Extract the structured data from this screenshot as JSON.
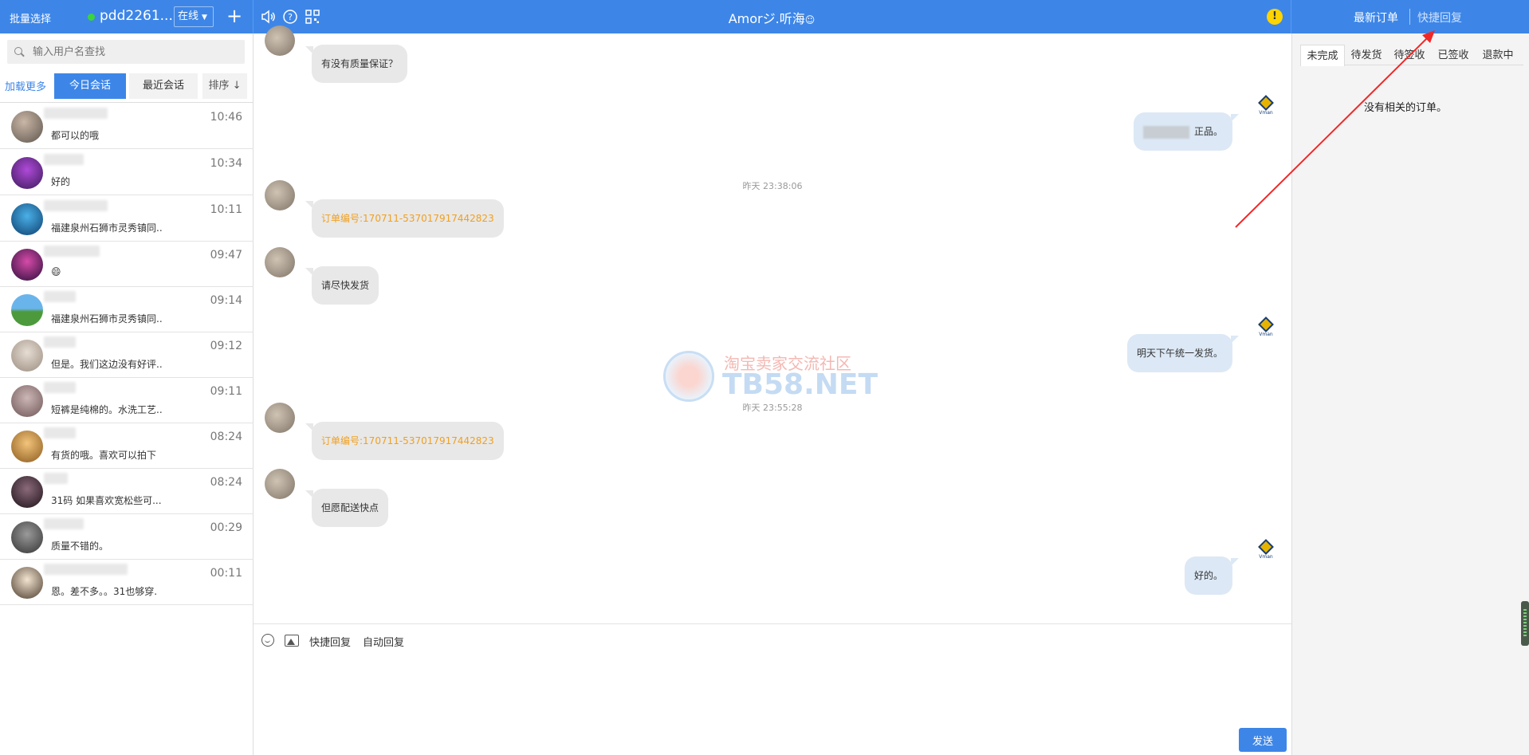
{
  "topbar": {
    "batch_select": "批量选择",
    "shop_name": "pdd2261...",
    "status": "在线",
    "add": "+",
    "chat_title": "Amorジ.听海",
    "alert": "!",
    "latest_orders": "最新订单",
    "quick_reply": "快捷回复",
    "icons": [
      "speaker-icon",
      "help-icon",
      "qrcode-icon"
    ],
    "accent_color": "#3d86e8"
  },
  "sidebar": {
    "search_placeholder": "输入用户名查找",
    "load_more": "加载更多",
    "tabs": [
      "今日会话",
      "最近会话",
      "排序 ↓"
    ],
    "conversations": [
      {
        "time": "10:46",
        "msg": "都可以的哦"
      },
      {
        "time": "10:34",
        "msg": "好的"
      },
      {
        "time": "10:11",
        "msg": "福建泉州石狮市灵秀镇同.."
      },
      {
        "time": "09:47",
        "msg": "😄"
      },
      {
        "time": "09:14",
        "msg": "福建泉州石狮市灵秀镇同.."
      },
      {
        "time": "09:12",
        "msg": "但是。我们这边没有好评.."
      },
      {
        "time": "09:11",
        "msg": "短裤是纯棉的。水洗工艺.."
      },
      {
        "time": "08:24",
        "msg": "有货的哦。喜欢可以拍下"
      },
      {
        "time": "08:24",
        "msg": "31码 如果喜欢宽松些可..."
      },
      {
        "time": "00:29",
        "msg": "质量不错的。"
      },
      {
        "time": "00:11",
        "msg": "恩。差不多。。31也够穿."
      }
    ]
  },
  "chat": {
    "messages": [
      {
        "side": "in",
        "text": "有没有质量保证？"
      },
      {
        "side": "out",
        "text": "正品。"
      },
      {
        "type": "time",
        "text": "昨天 23:38:06"
      },
      {
        "side": "in",
        "text": "订单编号:170711-537017917442823",
        "order": true
      },
      {
        "side": "in",
        "text": "请尽快发货"
      },
      {
        "side": "out",
        "text": "明天下午统一发货。"
      },
      {
        "type": "time",
        "text": "昨天 23:55:28"
      },
      {
        "side": "in",
        "text": "订单编号:170711-537017917442823",
        "order": true
      },
      {
        "side": "in",
        "text": "但愿配送快点"
      },
      {
        "side": "out",
        "text": "好的。"
      }
    ],
    "vman_label": "Vman",
    "watermark_cn": "淘宝卖家交流社区",
    "watermark_en": "TB58.NET"
  },
  "input": {
    "quick_reply": "快捷回复",
    "auto_reply": "自动回复",
    "send": "发送"
  },
  "orders": {
    "tabs": [
      "未完成",
      "待发货",
      "待签收",
      "已签收",
      "退款中"
    ],
    "empty": "没有相关的订单。"
  }
}
